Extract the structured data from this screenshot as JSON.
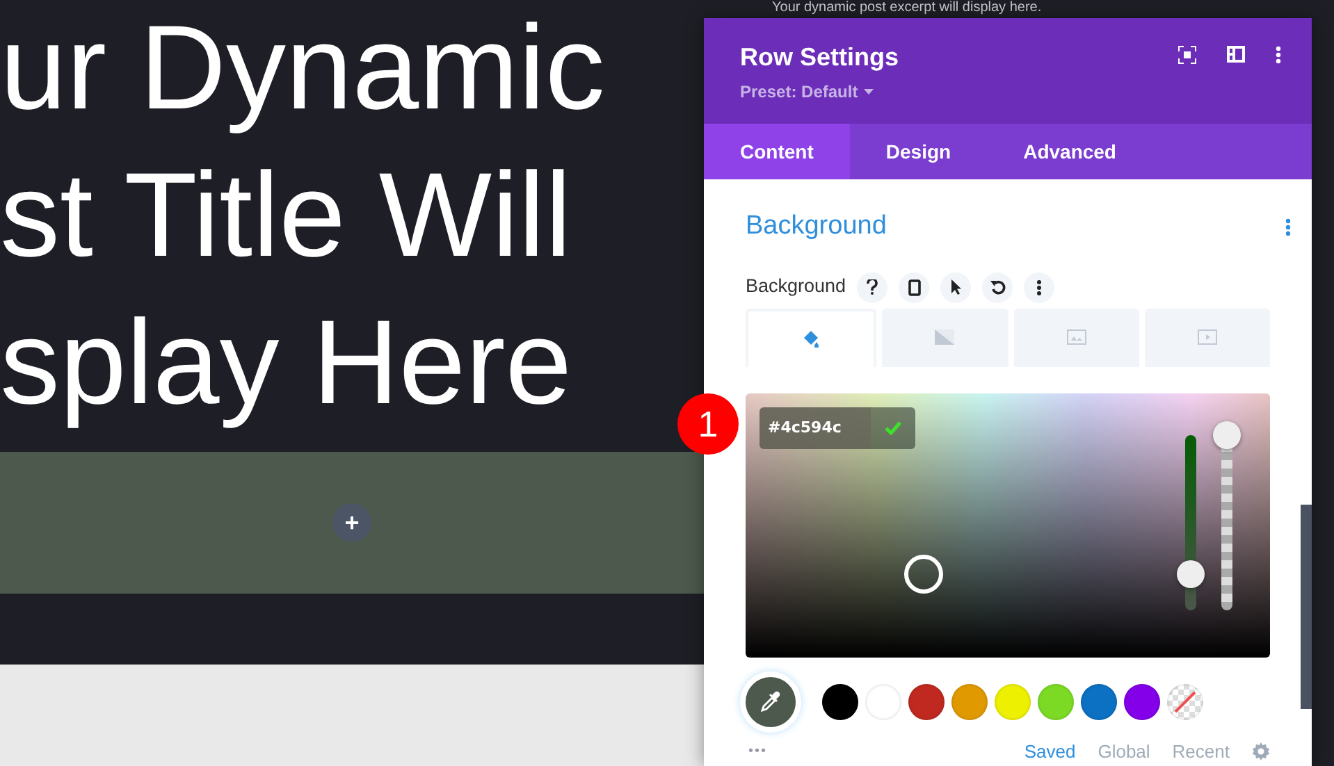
{
  "canvas": {
    "title_lines": [
      "ur Dynamic",
      "st Title Will",
      "splay Here"
    ],
    "excerpt": "Your dynamic post excerpt will display here.",
    "add_button": "+"
  },
  "annotation": {
    "label": "1"
  },
  "modal": {
    "title": "Row Settings",
    "preset": "Preset: Default",
    "tabs": [
      {
        "label": "Content",
        "selected": true
      },
      {
        "label": "Design",
        "selected": false
      },
      {
        "label": "Advanced",
        "selected": false
      }
    ],
    "section_title": "Background",
    "field_label": "Background",
    "background_types": [
      {
        "kind": "color",
        "selected": true
      },
      {
        "kind": "gradient",
        "selected": false
      },
      {
        "kind": "image",
        "selected": false
      },
      {
        "kind": "video",
        "selected": false
      }
    ],
    "hex_value": "#4c594c",
    "hue_slider": {
      "level": 0.2
    },
    "opacity_slider": {
      "level": 1
    },
    "swatches": [
      {
        "kind": "color",
        "color": "#000000"
      },
      {
        "kind": "color",
        "color": "#ffffff"
      },
      {
        "kind": "color",
        "color": "#c0291f"
      },
      {
        "kind": "color",
        "color": "#e09900"
      },
      {
        "kind": "color",
        "color": "#edf000"
      },
      {
        "kind": "color",
        "color": "#7cda24"
      },
      {
        "kind": "color",
        "color": "#0c71c3"
      },
      {
        "kind": "color",
        "color": "#8300e9"
      },
      {
        "kind": "none"
      }
    ],
    "more": "•••",
    "palette_tabs": [
      {
        "label": "Saved",
        "selected": true
      },
      {
        "label": "Global",
        "selected": false
      },
      {
        "label": "Recent",
        "selected": false
      }
    ]
  }
}
